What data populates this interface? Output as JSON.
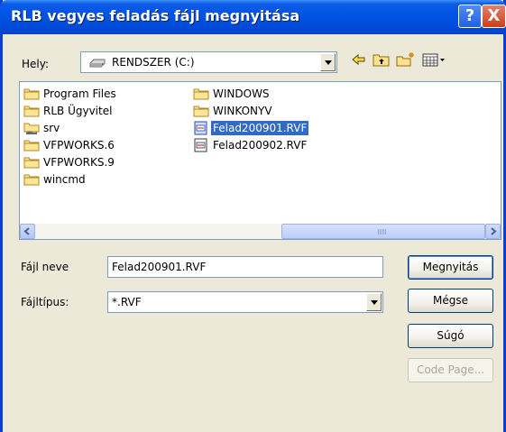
{
  "window": {
    "title": "RLB vegyes feladás fájl megnyitása"
  },
  "titlebar": {
    "help_glyph": "?",
    "close_glyph": "X"
  },
  "location": {
    "label": "Hely:",
    "value": "RENDSZER (C:)"
  },
  "files": [
    {
      "name": "Program Files",
      "icon": "folder-icon",
      "selected": false
    },
    {
      "name": "RLB Ügyvitel",
      "icon": "folder-icon",
      "selected": false
    },
    {
      "name": "srv",
      "icon": "shared-folder-icon",
      "selected": false
    },
    {
      "name": "VFPWORKS.6",
      "icon": "folder-icon",
      "selected": false
    },
    {
      "name": "VFPWORKS.9",
      "icon": "folder-icon",
      "selected": false
    },
    {
      "name": "wincmd",
      "icon": "folder-icon",
      "selected": false
    },
    {
      "name": "WINDOWS",
      "icon": "folder-icon",
      "selected": false
    },
    {
      "name": "WINKONYV",
      "icon": "folder-icon",
      "selected": false
    },
    {
      "name": "Felad200901.RVF",
      "icon": "rvf-file-icon",
      "selected": true
    },
    {
      "name": "Felad200902.RVF",
      "icon": "rvf-file-icon",
      "selected": false
    }
  ],
  "filename": {
    "label": "Fájl neve",
    "value": "Felad200901.RVF"
  },
  "filetype": {
    "label": "Fájltípus:",
    "value": "*.RVF"
  },
  "buttons": {
    "open": "Megnyitás",
    "cancel": "Mégse",
    "help": "Súgó",
    "code_page": "Code Page..."
  },
  "colors": {
    "titlebar": "#0054e3",
    "selection": "#316ac5",
    "dialog_bg": "#ece9d8"
  }
}
